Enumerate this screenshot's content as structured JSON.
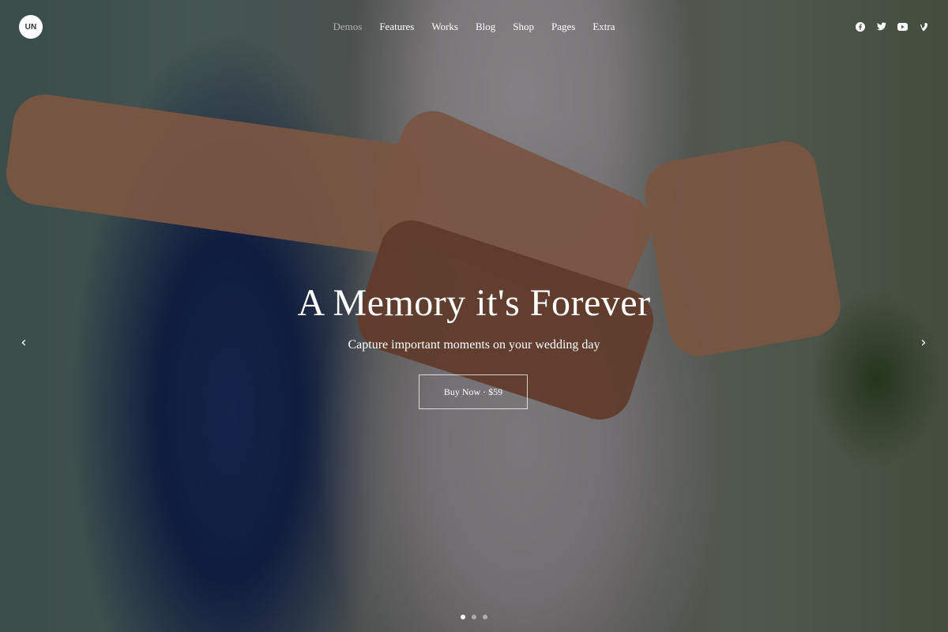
{
  "brand": {
    "logo_text": "UN"
  },
  "nav": {
    "items": [
      {
        "label": "Demos",
        "active": true
      },
      {
        "label": "Features"
      },
      {
        "label": "Works"
      },
      {
        "label": "Blog"
      },
      {
        "label": "Shop"
      },
      {
        "label": "Pages"
      },
      {
        "label": "Extra"
      }
    ]
  },
  "social": {
    "icons": [
      "facebook-icon",
      "twitter-icon",
      "youtube-icon",
      "vine-icon"
    ]
  },
  "slide": {
    "title": "A Memory it's Forever",
    "subtitle": "Capture important moments on your wedding day",
    "cta_label": "Buy Now · $59"
  },
  "slider": {
    "dot_count": 3,
    "active_dot": 1
  },
  "colors": {
    "text": "#ffffff",
    "overlay": "rgba(0,0,0,0.38)"
  }
}
